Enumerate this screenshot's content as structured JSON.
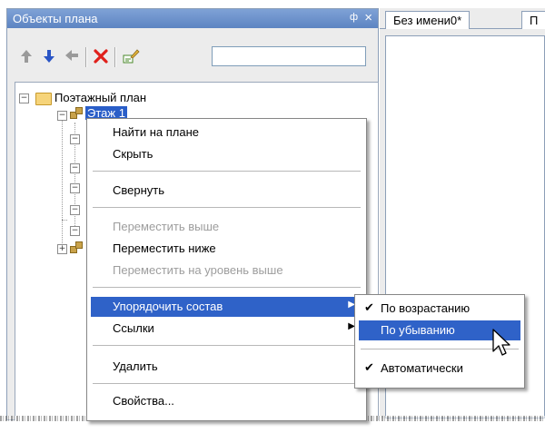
{
  "panel": {
    "title": "Объекты плана",
    "pin_glyph": "ф",
    "close_glyph": "×"
  },
  "toolbar": {
    "icons": [
      "arrow-up-icon",
      "arrow-down-icon",
      "arrow-left-icon",
      "delete-icon",
      "properties-icon"
    ],
    "search_value": ""
  },
  "tree": {
    "root": {
      "label": "Поэтажный план",
      "expander": "−"
    },
    "floor1": {
      "label": "Этаж 1",
      "expander": "−"
    },
    "child_expander": "−",
    "floor2_expander": "+"
  },
  "doc": {
    "tabs": [
      "Без имени0*",
      "П"
    ]
  },
  "context_menu": {
    "items": [
      {
        "label": "Найти на плане",
        "enabled": true
      },
      {
        "label": "Скрыть",
        "enabled": true
      },
      {
        "label": "Свернуть",
        "enabled": true
      },
      {
        "label": "Переместить выше",
        "enabled": false
      },
      {
        "label": "Переместить ниже",
        "enabled": true
      },
      {
        "label": "Переместить на уровень выше",
        "enabled": false
      },
      {
        "label": "Упорядочить состав",
        "enabled": true,
        "submenu": true,
        "active": true
      },
      {
        "label": "Ссылки",
        "enabled": true,
        "submenu": true
      },
      {
        "label": "Удалить",
        "enabled": true
      },
      {
        "label": "Свойства...",
        "enabled": true
      }
    ]
  },
  "submenu": {
    "items": [
      {
        "label": "По возрастанию",
        "checked": true
      },
      {
        "label": "По убыванию",
        "checked": false,
        "active": true
      },
      {
        "label": "Автоматически",
        "checked": true
      }
    ]
  },
  "colors": {
    "selection": "#2f62c8",
    "title_bar": "#6b8fcb",
    "delete_red": "#e0201b",
    "arrow_blue": "#2a55c5"
  }
}
